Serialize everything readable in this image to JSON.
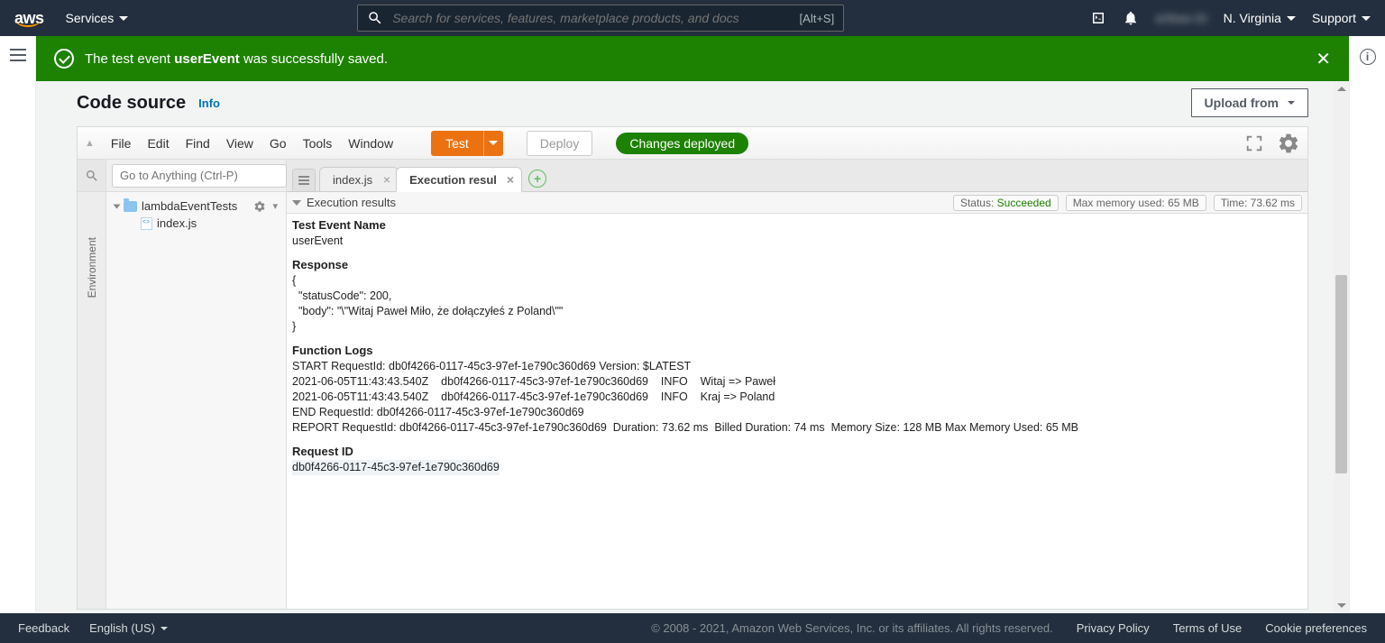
{
  "nav": {
    "services": "Services",
    "search_placeholder": "Search for services, features, marketplace products, and docs",
    "shortcut": "[Alt+S]",
    "account_blur": "aXbse-Di",
    "region": "N. Virginia",
    "support": "Support"
  },
  "banner": {
    "text_prefix": "The test event ",
    "event_name": "userEvent",
    "text_suffix": " was successfully saved."
  },
  "header": {
    "code_source": "Code source",
    "info": "Info",
    "upload_from": "Upload from"
  },
  "ide": {
    "menu": [
      "File",
      "Edit",
      "Find",
      "View",
      "Go",
      "Tools",
      "Window"
    ],
    "test": "Test",
    "deploy": "Deploy",
    "changes_deployed": "Changes deployed",
    "goto_placeholder": "Go to Anything (Ctrl-P)",
    "env_label": "Environment",
    "folder": "lambdaEventTests",
    "file": "index.js",
    "tabs": {
      "index": "index.js",
      "results": "Execution results"
    },
    "rh": {
      "title": "Execution results",
      "status_label": "Status: ",
      "status_value": "Succeeded",
      "mem_label": "Max memory used: ",
      "mem_value": "65 MB",
      "time_label": "Time: ",
      "time_value": "73.62 ms"
    },
    "body": {
      "test_event_name_label": "Test Event Name",
      "test_event_name": "userEvent",
      "response_label": "Response",
      "json_l1": "{",
      "json_l2": "  \"statusCode\": 200,",
      "json_l3": "  \"body\": \"\\\"Witaj Paweł Miło, że dołączyłeś z Poland\\\"\"",
      "json_l4": "}",
      "logs_label": "Function Logs",
      "log_l1": "START RequestId: db0f4266-0117-45c3-97ef-1e790c360d69 Version: $LATEST",
      "log_l2": "2021-06-05T11:43:43.540Z    db0f4266-0117-45c3-97ef-1e790c360d69    INFO    Witaj => Paweł",
      "log_l3": "2021-06-05T11:43:43.540Z    db0f4266-0117-45c3-97ef-1e790c360d69    INFO    Kraj => Poland",
      "log_l4": "END RequestId: db0f4266-0117-45c3-97ef-1e790c360d69",
      "log_l5": "REPORT RequestId: db0f4266-0117-45c3-97ef-1e790c360d69  Duration: 73.62 ms  Billed Duration: 74 ms  Memory Size: 128 MB Max Memory Used: 65 MB",
      "reqid_label": "Request ID",
      "reqid": "db0f4266-0117-45c3-97ef-1e790c360d69"
    }
  },
  "footer": {
    "feedback": "Feedback",
    "language": "English (US)",
    "copyright": "© 2008 - 2021, Amazon Web Services, Inc. or its affiliates. All rights reserved.",
    "privacy": "Privacy Policy",
    "terms": "Terms of Use",
    "cookies": "Cookie preferences"
  }
}
